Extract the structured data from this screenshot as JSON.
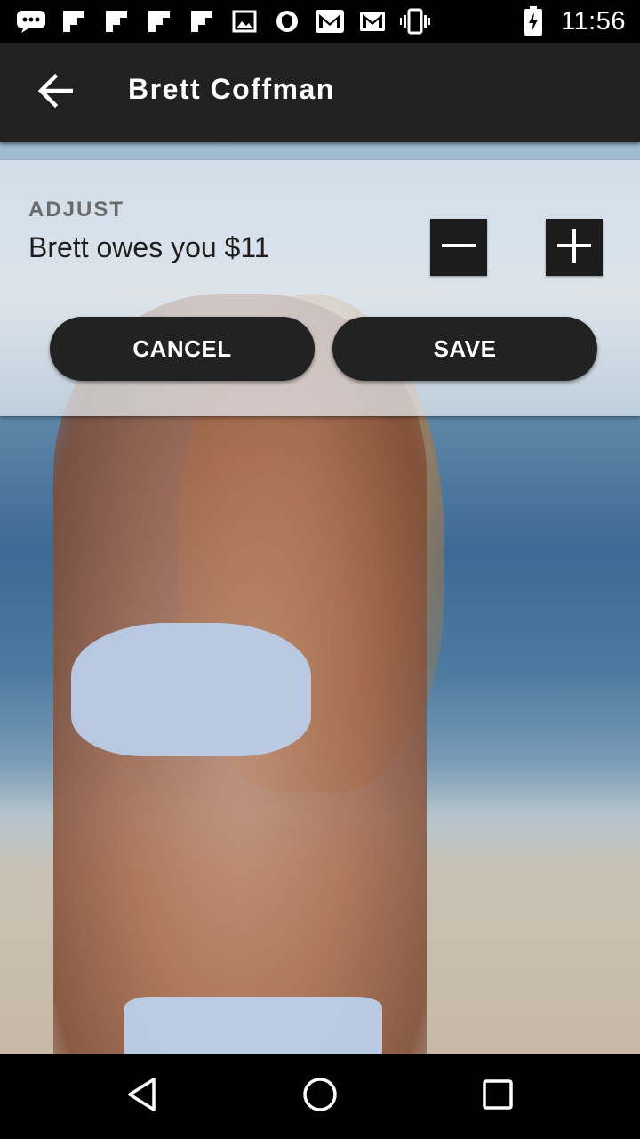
{
  "status_bar": {
    "time": "11:56",
    "icons": [
      "messaging-icon",
      "flipboard-icon",
      "flipboard-icon",
      "flipboard-icon",
      "flipboard-icon",
      "gallery-icon",
      "shield-icon",
      "mail-icon",
      "gmail-icon",
      "vibrate-icon",
      "battery-charging-icon"
    ]
  },
  "app_bar": {
    "title": "Brett Coffman",
    "back_icon": "arrow-back-icon"
  },
  "adjust": {
    "heading": "ADJUST",
    "balance_text": "Brett owes you $11",
    "decrement_icon": "minus-icon",
    "increment_icon": "plus-icon",
    "cancel_label": "CANCEL",
    "save_label": "SAVE"
  },
  "nav_bar": {
    "back": "nav-back-icon",
    "home": "nav-home-icon",
    "recent": "nav-recent-icon"
  },
  "colors": {
    "app_bar": "#212121",
    "buttons": "#222222",
    "panel_overlay": "#e4eaf0",
    "heading_text": "#6b6b6b"
  }
}
